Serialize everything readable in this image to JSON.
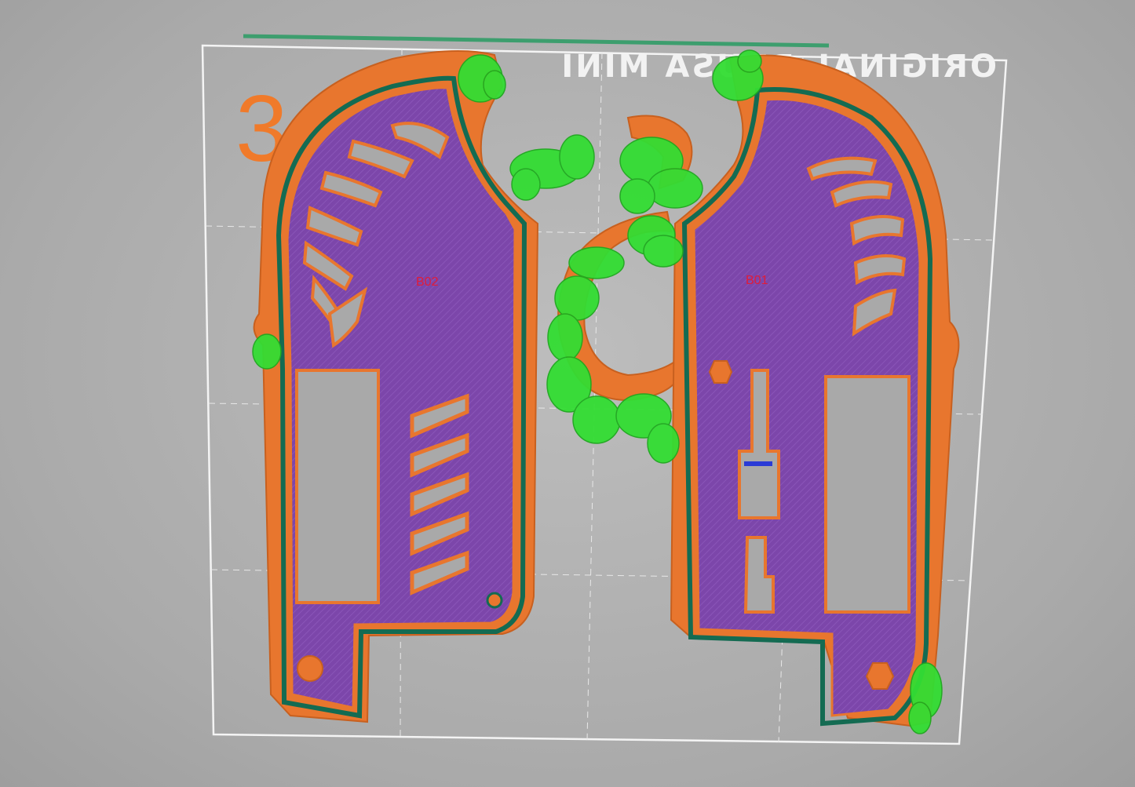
{
  "viewer": {
    "layer_number": "3",
    "bed_logo": "ORIGINAL PRUSA MINI"
  },
  "objects": [
    {
      "label": "B02"
    },
    {
      "label": "B01"
    }
  ],
  "colors": {
    "background": "#aaaaaa",
    "bed_outline": "#f4f4f4",
    "grid": "#e6e6e6",
    "perimeter": "#e8762e",
    "external_perimeter": "#146b52",
    "infill": "#7a44a8",
    "support": "#33dd33",
    "bridge": "#2a3bd6",
    "travel_marker": "#3d9e6e"
  }
}
